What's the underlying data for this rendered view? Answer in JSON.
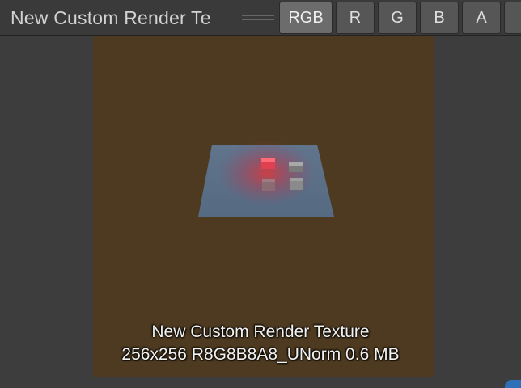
{
  "window": {
    "title": "New Custom Render Te"
  },
  "channels": {
    "rgb": "RGB",
    "r": "R",
    "g": "G",
    "b": "B",
    "a": "A",
    "active": "RGB"
  },
  "texture_info": {
    "name": "New Custom Render Texture",
    "details": "256x256  R8G8B8A8_UNorm  0.6 MB"
  },
  "colors": {
    "texture_background": "#4e3a20",
    "plane": "#5a6e86",
    "highlight": "#e0363a"
  }
}
